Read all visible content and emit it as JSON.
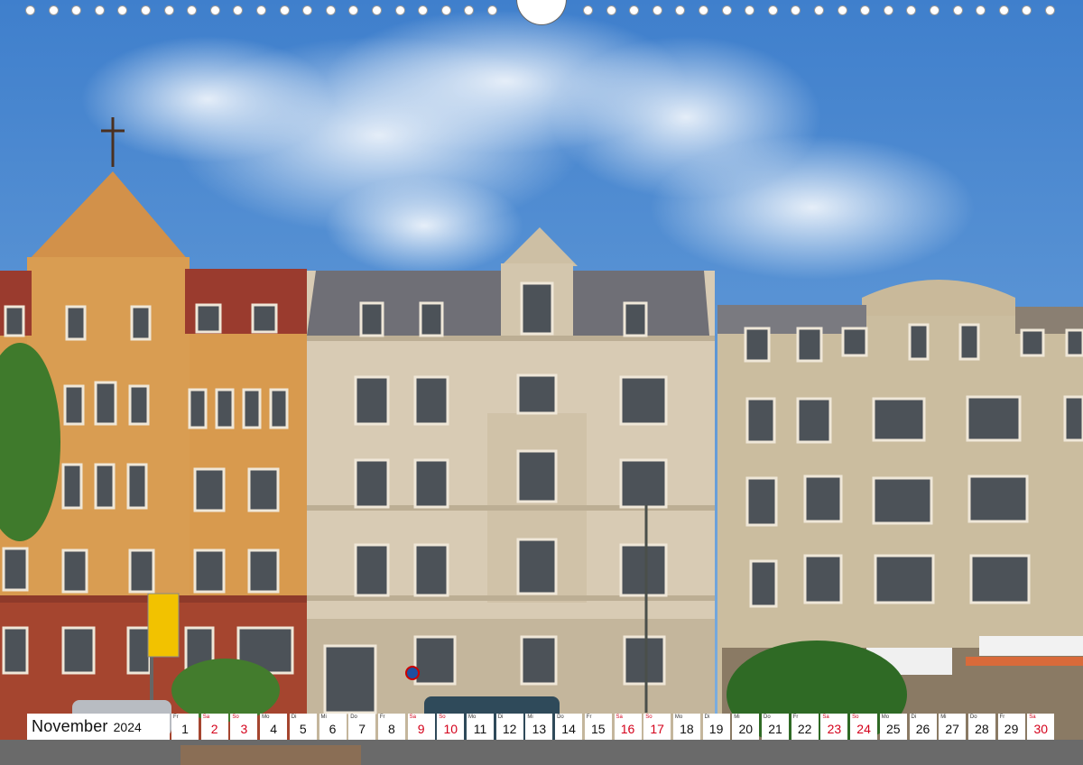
{
  "calendar": {
    "month": "November",
    "year": "2024",
    "accent_color": "#d4001a",
    "days": [
      {
        "dow": "Fr",
        "num": "1",
        "red": false
      },
      {
        "dow": "Sa",
        "num": "2",
        "red": true
      },
      {
        "dow": "So",
        "num": "3",
        "red": true
      },
      {
        "dow": "Mo",
        "num": "4",
        "red": false
      },
      {
        "dow": "Di",
        "num": "5",
        "red": false
      },
      {
        "dow": "Mi",
        "num": "6",
        "red": false
      },
      {
        "dow": "Do",
        "num": "7",
        "red": false
      },
      {
        "dow": "Fr",
        "num": "8",
        "red": false
      },
      {
        "dow": "Sa",
        "num": "9",
        "red": true
      },
      {
        "dow": "So",
        "num": "10",
        "red": true
      },
      {
        "dow": "Mo",
        "num": "11",
        "red": false
      },
      {
        "dow": "Di",
        "num": "12",
        "red": false
      },
      {
        "dow": "Mi",
        "num": "13",
        "red": false
      },
      {
        "dow": "Do",
        "num": "14",
        "red": false
      },
      {
        "dow": "Fr",
        "num": "15",
        "red": false
      },
      {
        "dow": "Sa",
        "num": "16",
        "red": true
      },
      {
        "dow": "So",
        "num": "17",
        "red": true
      },
      {
        "dow": "Mo",
        "num": "18",
        "red": false
      },
      {
        "dow": "Di",
        "num": "19",
        "red": false
      },
      {
        "dow": "Mi",
        "num": "20",
        "red": false
      },
      {
        "dow": "Do",
        "num": "21",
        "red": false
      },
      {
        "dow": "Fr",
        "num": "22",
        "red": false
      },
      {
        "dow": "Sa",
        "num": "23",
        "red": true
      },
      {
        "dow": "So",
        "num": "24",
        "red": true
      },
      {
        "dow": "Mo",
        "num": "25",
        "red": false
      },
      {
        "dow": "Di",
        "num": "26",
        "red": false
      },
      {
        "dow": "Mi",
        "num": "27",
        "red": false
      },
      {
        "dow": "Do",
        "num": "28",
        "red": false
      },
      {
        "dow": "Fr",
        "num": "29",
        "red": false
      },
      {
        "dow": "Sa",
        "num": "30",
        "red": true
      }
    ]
  },
  "photo": {
    "sky_color": "#4d8fd6",
    "sandstone_color": "#d8cbb4",
    "ochre_brick_color": "#d89a4e",
    "red_brick_color": "#a5452f",
    "roof_color": "#6f6f76",
    "tree_color": "#3f7a2c",
    "sign_color": "#f2c200",
    "sign_icons": [
      "parking-sign",
      "direction-sign"
    ]
  }
}
